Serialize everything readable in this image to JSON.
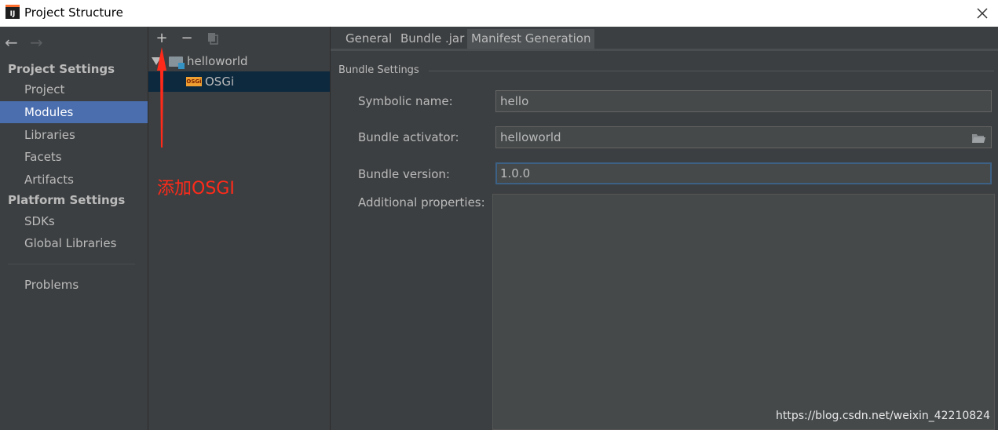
{
  "window": {
    "title": "Project Structure",
    "logo_text": "IJ"
  },
  "nav": {
    "back_glyph": "←",
    "forward_glyph": "→"
  },
  "sidebar": {
    "project_settings_title": "Project Settings",
    "project_items": [
      {
        "label": "Project",
        "selected": false
      },
      {
        "label": "Modules",
        "selected": true
      },
      {
        "label": "Libraries",
        "selected": false
      },
      {
        "label": "Facets",
        "selected": false
      },
      {
        "label": "Artifacts",
        "selected": false
      }
    ],
    "platform_settings_title": "Platform Settings",
    "platform_items": [
      {
        "label": "SDKs"
      },
      {
        "label": "Global Libraries"
      }
    ],
    "problems_label": "Problems"
  },
  "toolbar": {
    "add_glyph": "+",
    "remove_glyph": "−"
  },
  "tree": {
    "root": {
      "label": "helloworld",
      "icon": "folder-module-icon"
    },
    "child": {
      "label": "OSGi",
      "icon": "osgi-icon",
      "badge": "OSGi",
      "selected": true
    }
  },
  "annotation": {
    "text": "添加OSGI",
    "color": "#ff2a1a"
  },
  "tabs": [
    {
      "label": "General",
      "selected": false
    },
    {
      "label": "Bundle .jar",
      "selected": false
    },
    {
      "label": "Manifest Generation",
      "selected": true
    }
  ],
  "form": {
    "group_title": "Bundle Settings",
    "symbolic_name": {
      "label": "Symbolic name:",
      "value": "hello"
    },
    "bundle_activator": {
      "label": "Bundle activator:",
      "value": "helloworld"
    },
    "bundle_version": {
      "label": "Bundle version:",
      "value": "1.0.0"
    },
    "additional_properties": {
      "label": "Additional properties:",
      "value": ""
    }
  },
  "watermark": "https://blog.csdn.net/weixin_42210824",
  "colors": {
    "selection": "#4b6eaf",
    "tree_selection": "#0d293e",
    "panel": "#3c3f41",
    "focus": "#3d6185"
  }
}
